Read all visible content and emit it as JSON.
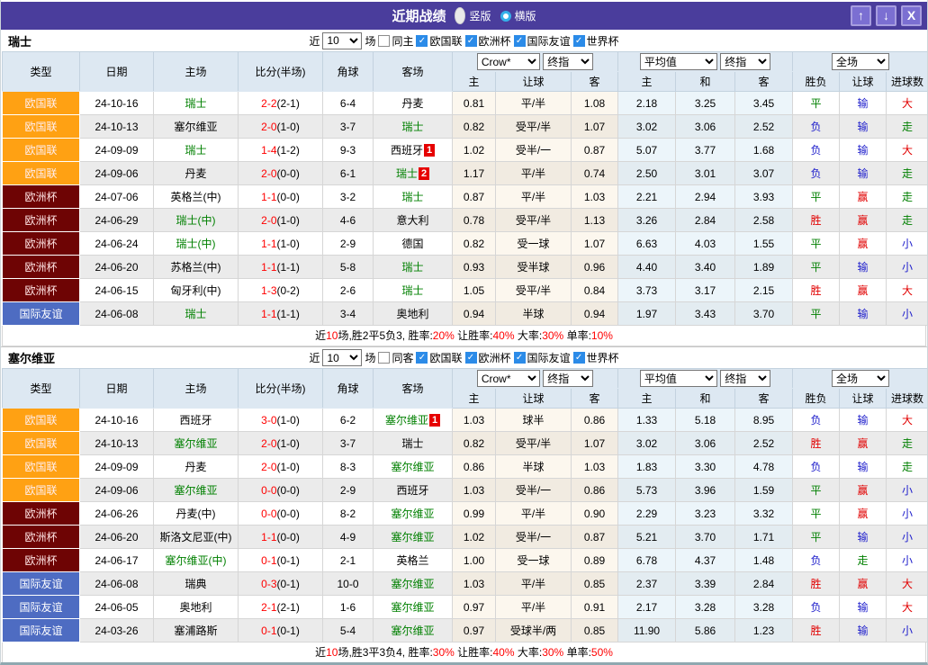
{
  "header": {
    "title": "近期战绩",
    "vertical_label": "竖版",
    "horizontal_label": "横版"
  },
  "icons": {
    "up": "↑",
    "down": "↓",
    "close": "X",
    "check": "✓"
  },
  "colors": {
    "titlebar": "#4a3d9c",
    "title_button": "#7b6fd2",
    "title_button_border": "#a79ddf",
    "radio_ring": "#35b1ea",
    "checkbox_checked": "#2b8be8",
    "header_cell_bg": "#dde8f2",
    "row_alt_bg": "#ebebeb",
    "crow_col_tint": "#fcf7ee",
    "avg_col_tint": "#ecf5fa",
    "team_green": "#008000",
    "score_red": "#ff0000",
    "summary_red": "#ff0000",
    "badge_bg": "#e60000",
    "badge_text": "#ffffff",
    "outcome": {
      "r": "#e10000",
      "g": "#008000",
      "b": "#2020cc",
      "k": "#000000"
    },
    "type": {
      "orange": {
        "bg": "#ffa113",
        "text": "#ffeded"
      },
      "darkred": {
        "bg": "#6e0404",
        "text": "#ffe3e3"
      },
      "blue": {
        "bg": "#4e6cc2",
        "text": "#ffffff"
      }
    }
  },
  "filter_labels": {
    "near": "近",
    "games": "场"
  },
  "table_header": {
    "type": "类型",
    "date": "日期",
    "home": "主场",
    "score": "比分(半场)",
    "corner": "角球",
    "away": "客场",
    "selects": {
      "bookmaker": "Crow*",
      "final": "终指",
      "average": "平均值",
      "final2": "终指",
      "scope": "全场"
    },
    "sub": {
      "home": "主",
      "handicap": "让球",
      "away": "客",
      "avg_home": "主",
      "avg_draw": "和",
      "avg_away": "客",
      "result": "胜负",
      "handicap_result": "让球",
      "goals": "进球数"
    }
  },
  "sections": [
    {
      "team": "瑞士",
      "filter": {
        "count": "10",
        "same": "同主",
        "leagues": [
          "欧国联",
          "欧洲杯",
          "国际友谊",
          "世界杯"
        ]
      },
      "rows": [
        {
          "type": "欧国联",
          "tc": "orange",
          "date": "24-10-16",
          "home": "瑞士",
          "hg": 1,
          "score": "2-2",
          "half": "(2-1)",
          "corner": "6-4",
          "away": "丹麦",
          "ag": 0,
          "ab": "",
          "o": [
            "0.81",
            "平/半",
            "1.08"
          ],
          "a": [
            "2.18",
            "3.25",
            "3.45"
          ],
          "res": [
            "平",
            "g"
          ],
          "hres": [
            "输",
            "b"
          ],
          "gres": [
            "大",
            "r"
          ]
        },
        {
          "type": "欧国联",
          "tc": "orange",
          "date": "24-10-13",
          "home": "塞尔维亚",
          "hg": 0,
          "score": "2-0",
          "half": "(1-0)",
          "corner": "3-7",
          "away": "瑞士",
          "ag": 1,
          "ab": "",
          "o": [
            "0.82",
            "受平/半",
            "1.07"
          ],
          "a": [
            "3.02",
            "3.06",
            "2.52"
          ],
          "res": [
            "负",
            "b"
          ],
          "hres": [
            "输",
            "b"
          ],
          "gres": [
            "走",
            "g"
          ]
        },
        {
          "type": "欧国联",
          "tc": "orange",
          "date": "24-09-09",
          "home": "瑞士",
          "hg": 1,
          "score": "1-4",
          "half": "(1-2)",
          "corner": "9-3",
          "away": "西班牙",
          "ag": 0,
          "ab": "1",
          "o": [
            "1.02",
            "受半/一",
            "0.87"
          ],
          "a": [
            "5.07",
            "3.77",
            "1.68"
          ],
          "res": [
            "负",
            "b"
          ],
          "hres": [
            "输",
            "b"
          ],
          "gres": [
            "大",
            "r"
          ]
        },
        {
          "type": "欧国联",
          "tc": "orange",
          "date": "24-09-06",
          "home": "丹麦",
          "hg": 0,
          "score": "2-0",
          "half": "(0-0)",
          "corner": "6-1",
          "away": "瑞士",
          "ag": 1,
          "ab": "2",
          "o": [
            "1.17",
            "平/半",
            "0.74"
          ],
          "a": [
            "2.50",
            "3.01",
            "3.07"
          ],
          "res": [
            "负",
            "b"
          ],
          "hres": [
            "输",
            "b"
          ],
          "gres": [
            "走",
            "g"
          ]
        },
        {
          "type": "欧洲杯",
          "tc": "darkred",
          "date": "24-07-06",
          "home": "英格兰(中)",
          "hg": 0,
          "score": "1-1",
          "half": "(0-0)",
          "corner": "3-2",
          "away": "瑞士",
          "ag": 1,
          "ab": "",
          "o": [
            "0.87",
            "平/半",
            "1.03"
          ],
          "a": [
            "2.21",
            "2.94",
            "3.93"
          ],
          "res": [
            "平",
            "g"
          ],
          "hres": [
            "赢",
            "r"
          ],
          "gres": [
            "走",
            "g"
          ]
        },
        {
          "type": "欧洲杯",
          "tc": "darkred",
          "date": "24-06-29",
          "home": "瑞士(中)",
          "hg": 1,
          "score": "2-0",
          "half": "(1-0)",
          "corner": "4-6",
          "away": "意大利",
          "ag": 0,
          "ab": "",
          "o": [
            "0.78",
            "受平/半",
            "1.13"
          ],
          "a": [
            "3.26",
            "2.84",
            "2.58"
          ],
          "res": [
            "胜",
            "r"
          ],
          "hres": [
            "赢",
            "r"
          ],
          "gres": [
            "走",
            "g"
          ]
        },
        {
          "type": "欧洲杯",
          "tc": "darkred",
          "date": "24-06-24",
          "home": "瑞士(中)",
          "hg": 1,
          "score": "1-1",
          "half": "(1-0)",
          "corner": "2-9",
          "away": "德国",
          "ag": 0,
          "ab": "",
          "o": [
            "0.82",
            "受一球",
            "1.07"
          ],
          "a": [
            "6.63",
            "4.03",
            "1.55"
          ],
          "res": [
            "平",
            "g"
          ],
          "hres": [
            "赢",
            "r"
          ],
          "gres": [
            "小",
            "b"
          ]
        },
        {
          "type": "欧洲杯",
          "tc": "darkred",
          "date": "24-06-20",
          "home": "苏格兰(中)",
          "hg": 0,
          "score": "1-1",
          "half": "(1-1)",
          "corner": "5-8",
          "away": "瑞士",
          "ag": 1,
          "ab": "",
          "o": [
            "0.93",
            "受半球",
            "0.96"
          ],
          "a": [
            "4.40",
            "3.40",
            "1.89"
          ],
          "res": [
            "平",
            "g"
          ],
          "hres": [
            "输",
            "b"
          ],
          "gres": [
            "小",
            "b"
          ]
        },
        {
          "type": "欧洲杯",
          "tc": "darkred",
          "date": "24-06-15",
          "home": "匈牙利(中)",
          "hg": 0,
          "score": "1-3",
          "half": "(0-2)",
          "corner": "2-6",
          "away": "瑞士",
          "ag": 1,
          "ab": "",
          "o": [
            "1.05",
            "受平/半",
            "0.84"
          ],
          "a": [
            "3.73",
            "3.17",
            "2.15"
          ],
          "res": [
            "胜",
            "r"
          ],
          "hres": [
            "赢",
            "r"
          ],
          "gres": [
            "大",
            "r"
          ]
        },
        {
          "type": "国际友谊",
          "tc": "blue",
          "date": "24-06-08",
          "home": "瑞士",
          "hg": 1,
          "score": "1-1",
          "half": "(1-1)",
          "corner": "3-4",
          "away": "奥地利",
          "ag": 0,
          "ab": "",
          "o": [
            "0.94",
            "半球",
            "0.94"
          ],
          "a": [
            "1.97",
            "3.43",
            "3.70"
          ],
          "res": [
            "平",
            "g"
          ],
          "hres": [
            "输",
            "b"
          ],
          "gres": [
            "小",
            "b"
          ]
        }
      ],
      "summary": [
        {
          "t": "近",
          "r": 0
        },
        {
          "t": "10",
          "r": 1
        },
        {
          "t": "场,胜2平5负3, 胜率:",
          "r": 0
        },
        {
          "t": "20%",
          "r": 1
        },
        {
          "t": " 让胜率:",
          "r": 0
        },
        {
          "t": "40%",
          "r": 1
        },
        {
          "t": " 大率:",
          "r": 0
        },
        {
          "t": "30%",
          "r": 1
        },
        {
          "t": " 单率:",
          "r": 0
        },
        {
          "t": "10%",
          "r": 1
        }
      ]
    },
    {
      "team": "塞尔维亚",
      "filter": {
        "count": "10",
        "same": "同客",
        "leagues": [
          "欧国联",
          "欧洲杯",
          "国际友谊",
          "世界杯"
        ]
      },
      "rows": [
        {
          "type": "欧国联",
          "tc": "orange",
          "date": "24-10-16",
          "home": "西班牙",
          "hg": 0,
          "score": "3-0",
          "half": "(1-0)",
          "corner": "6-2",
          "away": "塞尔维亚",
          "ag": 1,
          "ab": "1",
          "o": [
            "1.03",
            "球半",
            "0.86"
          ],
          "a": [
            "1.33",
            "5.18",
            "8.95"
          ],
          "res": [
            "负",
            "b"
          ],
          "hres": [
            "输",
            "b"
          ],
          "gres": [
            "大",
            "r"
          ]
        },
        {
          "type": "欧国联",
          "tc": "orange",
          "date": "24-10-13",
          "home": "塞尔维亚",
          "hg": 1,
          "score": "2-0",
          "half": "(1-0)",
          "corner": "3-7",
          "away": "瑞士",
          "ag": 0,
          "ab": "",
          "o": [
            "0.82",
            "受平/半",
            "1.07"
          ],
          "a": [
            "3.02",
            "3.06",
            "2.52"
          ],
          "res": [
            "胜",
            "r"
          ],
          "hres": [
            "赢",
            "r"
          ],
          "gres": [
            "走",
            "g"
          ]
        },
        {
          "type": "欧国联",
          "tc": "orange",
          "date": "24-09-09",
          "home": "丹麦",
          "hg": 0,
          "score": "2-0",
          "half": "(1-0)",
          "corner": "8-3",
          "away": "塞尔维亚",
          "ag": 1,
          "ab": "",
          "o": [
            "0.86",
            "半球",
            "1.03"
          ],
          "a": [
            "1.83",
            "3.30",
            "4.78"
          ],
          "res": [
            "负",
            "b"
          ],
          "hres": [
            "输",
            "b"
          ],
          "gres": [
            "走",
            "g"
          ]
        },
        {
          "type": "欧国联",
          "tc": "orange",
          "date": "24-09-06",
          "home": "塞尔维亚",
          "hg": 1,
          "score": "0-0",
          "half": "(0-0)",
          "corner": "2-9",
          "away": "西班牙",
          "ag": 0,
          "ab": "",
          "o": [
            "1.03",
            "受半/一",
            "0.86"
          ],
          "a": [
            "5.73",
            "3.96",
            "1.59"
          ],
          "res": [
            "平",
            "g"
          ],
          "hres": [
            "赢",
            "r"
          ],
          "gres": [
            "小",
            "b"
          ]
        },
        {
          "type": "欧洲杯",
          "tc": "darkred",
          "date": "24-06-26",
          "home": "丹麦(中)",
          "hg": 0,
          "score": "0-0",
          "half": "(0-0)",
          "corner": "8-2",
          "away": "塞尔维亚",
          "ag": 1,
          "ab": "",
          "o": [
            "0.99",
            "平/半",
            "0.90"
          ],
          "a": [
            "2.29",
            "3.23",
            "3.32"
          ],
          "res": [
            "平",
            "g"
          ],
          "hres": [
            "赢",
            "r"
          ],
          "gres": [
            "小",
            "b"
          ]
        },
        {
          "type": "欧洲杯",
          "tc": "darkred",
          "date": "24-06-20",
          "home": "斯洛文尼亚(中)",
          "hg": 0,
          "score": "1-1",
          "half": "(0-0)",
          "corner": "4-9",
          "away": "塞尔维亚",
          "ag": 1,
          "ab": "",
          "o": [
            "1.02",
            "受半/一",
            "0.87"
          ],
          "a": [
            "5.21",
            "3.70",
            "1.71"
          ],
          "res": [
            "平",
            "g"
          ],
          "hres": [
            "输",
            "b"
          ],
          "gres": [
            "小",
            "b"
          ]
        },
        {
          "type": "欧洲杯",
          "tc": "darkred",
          "date": "24-06-17",
          "home": "塞尔维亚(中)",
          "hg": 1,
          "score": "0-1",
          "half": "(0-1)",
          "corner": "2-1",
          "away": "英格兰",
          "ag": 0,
          "ab": "",
          "o": [
            "1.00",
            "受一球",
            "0.89"
          ],
          "a": [
            "6.78",
            "4.37",
            "1.48"
          ],
          "res": [
            "负",
            "b"
          ],
          "hres": [
            "走",
            "g"
          ],
          "gres": [
            "小",
            "b"
          ]
        },
        {
          "type": "国际友谊",
          "tc": "blue",
          "date": "24-06-08",
          "home": "瑞典",
          "hg": 0,
          "score": "0-3",
          "half": "(0-1)",
          "corner": "10-0",
          "away": "塞尔维亚",
          "ag": 1,
          "ab": "",
          "o": [
            "1.03",
            "平/半",
            "0.85"
          ],
          "a": [
            "2.37",
            "3.39",
            "2.84"
          ],
          "res": [
            "胜",
            "r"
          ],
          "hres": [
            "赢",
            "r"
          ],
          "gres": [
            "大",
            "r"
          ]
        },
        {
          "type": "国际友谊",
          "tc": "blue",
          "date": "24-06-05",
          "home": "奥地利",
          "hg": 0,
          "score": "2-1",
          "half": "(2-1)",
          "corner": "1-6",
          "away": "塞尔维亚",
          "ag": 1,
          "ab": "",
          "o": [
            "0.97",
            "平/半",
            "0.91"
          ],
          "a": [
            "2.17",
            "3.28",
            "3.28"
          ],
          "res": [
            "负",
            "b"
          ],
          "hres": [
            "输",
            "b"
          ],
          "gres": [
            "大",
            "r"
          ]
        },
        {
          "type": "国际友谊",
          "tc": "blue",
          "date": "24-03-26",
          "home": "塞浦路斯",
          "hg": 0,
          "score": "0-1",
          "half": "(0-1)",
          "corner": "5-4",
          "away": "塞尔维亚",
          "ag": 1,
          "ab": "",
          "o": [
            "0.97",
            "受球半/两",
            "0.85"
          ],
          "a": [
            "11.90",
            "5.86",
            "1.23"
          ],
          "res": [
            "胜",
            "r"
          ],
          "hres": [
            "输",
            "b"
          ],
          "gres": [
            "小",
            "b"
          ]
        }
      ],
      "summary": [
        {
          "t": "近",
          "r": 0
        },
        {
          "t": "10",
          "r": 1
        },
        {
          "t": "场,胜3平3负4, 胜率:",
          "r": 0
        },
        {
          "t": "30%",
          "r": 1
        },
        {
          "t": " 让胜率:",
          "r": 0
        },
        {
          "t": "40%",
          "r": 1
        },
        {
          "t": " 大率:",
          "r": 0
        },
        {
          "t": "30%",
          "r": 1
        },
        {
          "t": " 单率:",
          "r": 0
        },
        {
          "t": "50%",
          "r": 1
        }
      ]
    }
  ]
}
